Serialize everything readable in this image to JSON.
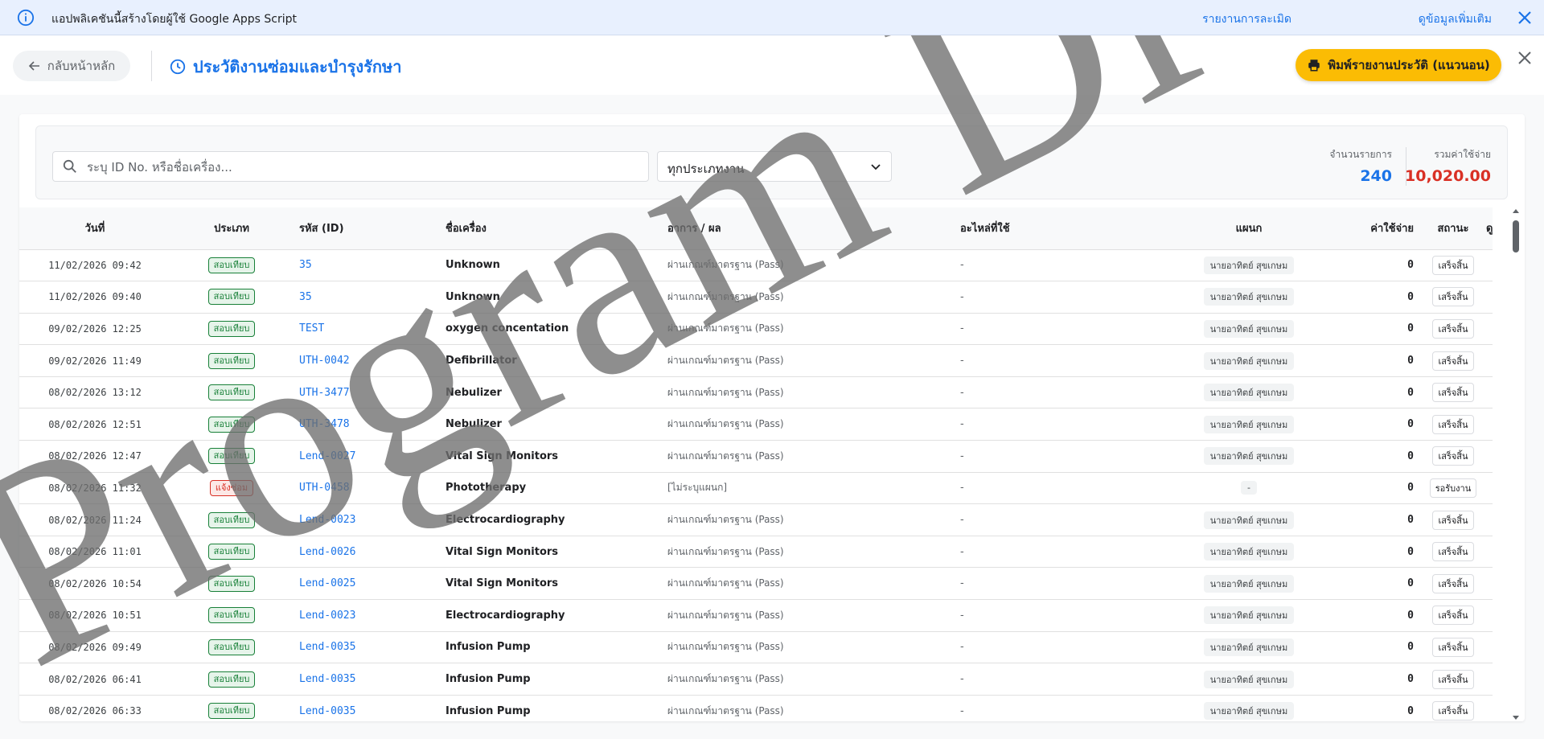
{
  "banner": {
    "text": "แอปพลิเคชันนี้สร้างโดยผู้ใช้ Google Apps Script",
    "report_link": "รายงานการละเมิด",
    "more_link": "ดูข้อมูลเพิ่มเติม"
  },
  "header": {
    "back_label": "กลับหน้าหลัก",
    "title": "ประวัติงานซ่อมและบำรุงรักษา",
    "print_label": "พิมพ์รายงานประวัติ (แนวนอน)"
  },
  "filters": {
    "search_placeholder": "ระบุ ID No. หรือชื่อเครื่อง...",
    "type_selected": "ทุกประเภทงาน"
  },
  "stats": {
    "count_label": "จำนวนรายการ",
    "count_value": "240",
    "total_label": "รวมค่าใช้จ่าย",
    "total_value": "10,020.00"
  },
  "table": {
    "headers": {
      "date": "วันที่",
      "type": "ประเภท",
      "id": "รหัส (ID)",
      "name": "ชื่อเครื่อง",
      "symptom": "อาการ / ผล",
      "parts": "อะไหล่ที่ใช้",
      "tech": "แผนก",
      "cost": "ค่าใช้จ่าย",
      "status": "สถานะ",
      "extra": "ดู"
    },
    "rows": [
      {
        "date": "11/02/2026 09:42",
        "type": "สอบเทียบ",
        "type_color": "green",
        "id": "35",
        "name": "Unknown",
        "symptom": "ผ่านเกณฑ์มาตรฐาน (Pass)",
        "parts": "-",
        "tech": "นายอาทิตย์ สุขเกษม",
        "cost": "0",
        "status": "เสร็จสิ้น"
      },
      {
        "date": "11/02/2026 09:40",
        "type": "สอบเทียบ",
        "type_color": "green",
        "id": "35",
        "name": "Unknown",
        "symptom": "ผ่านเกณฑ์มาตรฐาน (Pass)",
        "parts": "-",
        "tech": "นายอาทิตย์ สุขเกษม",
        "cost": "0",
        "status": "เสร็จสิ้น"
      },
      {
        "date": "09/02/2026 12:25",
        "type": "สอบเทียบ",
        "type_color": "green",
        "id": "TEST",
        "name": "oxygen concentation",
        "symptom": "ผ่านเกณฑ์มาตรฐาน (Pass)",
        "parts": "-",
        "tech": "นายอาทิตย์ สุขเกษม",
        "cost": "0",
        "status": "เสร็จสิ้น"
      },
      {
        "date": "09/02/2026 11:49",
        "type": "สอบเทียบ",
        "type_color": "green",
        "id": "UTH-0042",
        "name": "Defibrillator",
        "symptom": "ผ่านเกณฑ์มาตรฐาน (Pass)",
        "parts": "-",
        "tech": "นายอาทิตย์ สุขเกษม",
        "cost": "0",
        "status": "เสร็จสิ้น"
      },
      {
        "date": "08/02/2026 13:12",
        "type": "สอบเทียบ",
        "type_color": "green",
        "id": "UTH-3477",
        "name": "Nebulizer",
        "symptom": "ผ่านเกณฑ์มาตรฐาน (Pass)",
        "parts": "-",
        "tech": "นายอาทิตย์ สุขเกษม",
        "cost": "0",
        "status": "เสร็จสิ้น"
      },
      {
        "date": "08/02/2026 12:51",
        "type": "สอบเทียบ",
        "type_color": "green",
        "id": "UTH-3478",
        "name": "Nebulizer",
        "symptom": "ผ่านเกณฑ์มาตรฐาน (Pass)",
        "parts": "-",
        "tech": "นายอาทิตย์ สุขเกษม",
        "cost": "0",
        "status": "เสร็จสิ้น"
      },
      {
        "date": "08/02/2026 12:47",
        "type": "สอบเทียบ",
        "type_color": "green",
        "id": "Lend-0027",
        "name": "Vital Sign Monitors",
        "symptom": "ผ่านเกณฑ์มาตรฐาน (Pass)",
        "parts": "-",
        "tech": "นายอาทิตย์ สุขเกษม",
        "cost": "0",
        "status": "เสร็จสิ้น"
      },
      {
        "date": "08/02/2026 11:32",
        "type": "แจ้งซ่อม",
        "type_color": "red",
        "id": "UTH-0458",
        "name": "Phototherapy",
        "symptom": "[ไม่ระบุแผนก]",
        "parts": "-",
        "tech": "-",
        "cost": "0",
        "status": "รอรับงาน"
      },
      {
        "date": "08/02/2026 11:24",
        "type": "สอบเทียบ",
        "type_color": "green",
        "id": "Lend-0023",
        "name": "Electrocardiography",
        "symptom": "ผ่านเกณฑ์มาตรฐาน (Pass)",
        "parts": "-",
        "tech": "นายอาทิตย์ สุขเกษม",
        "cost": "0",
        "status": "เสร็จสิ้น"
      },
      {
        "date": "08/02/2026 11:01",
        "type": "สอบเทียบ",
        "type_color": "green",
        "id": "Lend-0026",
        "name": "Vital Sign Monitors",
        "symptom": "ผ่านเกณฑ์มาตรฐาน (Pass)",
        "parts": "-",
        "tech": "นายอาทิตย์ สุขเกษม",
        "cost": "0",
        "status": "เสร็จสิ้น"
      },
      {
        "date": "08/02/2026 10:54",
        "type": "สอบเทียบ",
        "type_color": "green",
        "id": "Lend-0025",
        "name": "Vital Sign Monitors",
        "symptom": "ผ่านเกณฑ์มาตรฐาน (Pass)",
        "parts": "-",
        "tech": "นายอาทิตย์ สุขเกษม",
        "cost": "0",
        "status": "เสร็จสิ้น"
      },
      {
        "date": "08/02/2026 10:51",
        "type": "สอบเทียบ",
        "type_color": "green",
        "id": "Lend-0023",
        "name": "Electrocardiography",
        "symptom": "ผ่านเกณฑ์มาตรฐาน (Pass)",
        "parts": "-",
        "tech": "นายอาทิตย์ สุขเกษม",
        "cost": "0",
        "status": "เสร็จสิ้น"
      },
      {
        "date": "08/02/2026 09:49",
        "type": "สอบเทียบ",
        "type_color": "green",
        "id": "Lend-0035",
        "name": "Infusion Pump",
        "symptom": "ผ่านเกณฑ์มาตรฐาน (Pass)",
        "parts": "-",
        "tech": "นายอาทิตย์ สุขเกษม",
        "cost": "0",
        "status": "เสร็จสิ้น"
      },
      {
        "date": "08/02/2026 06:41",
        "type": "สอบเทียบ",
        "type_color": "green",
        "id": "Lend-0035",
        "name": "Infusion Pump",
        "symptom": "ผ่านเกณฑ์มาตรฐาน (Pass)",
        "parts": "-",
        "tech": "นายอาทิตย์ สุขเกษม",
        "cost": "0",
        "status": "เสร็จสิ้น"
      },
      {
        "date": "08/02/2026 06:33",
        "type": "สอบเทียบ",
        "type_color": "green",
        "id": "Lend-0035",
        "name": "Infusion Pump",
        "symptom": "ผ่านเกณฑ์มาตรฐาน (Pass)",
        "parts": "-",
        "tech": "นายอาทิตย์ สุขเกษม",
        "cost": "0",
        "status": "เสร็จสิ้น"
      }
    ]
  },
  "watermark": {
    "text": "Program Di"
  },
  "colors": {
    "accent": "#1a73e8",
    "print_button": "#fbbc04",
    "total_red": "#d93025",
    "badge_green": "#188038",
    "badge_red": "#d93025",
    "banner_bg": "#e8f0fe"
  },
  "icons": {
    "banner_info": "info-icon",
    "banner_close": "close-icon",
    "back": "arrow-left-icon",
    "title": "clock-icon",
    "print": "printer-icon",
    "close_app": "close-icon",
    "search": "search-icon",
    "select": "chevron-down-icon"
  }
}
